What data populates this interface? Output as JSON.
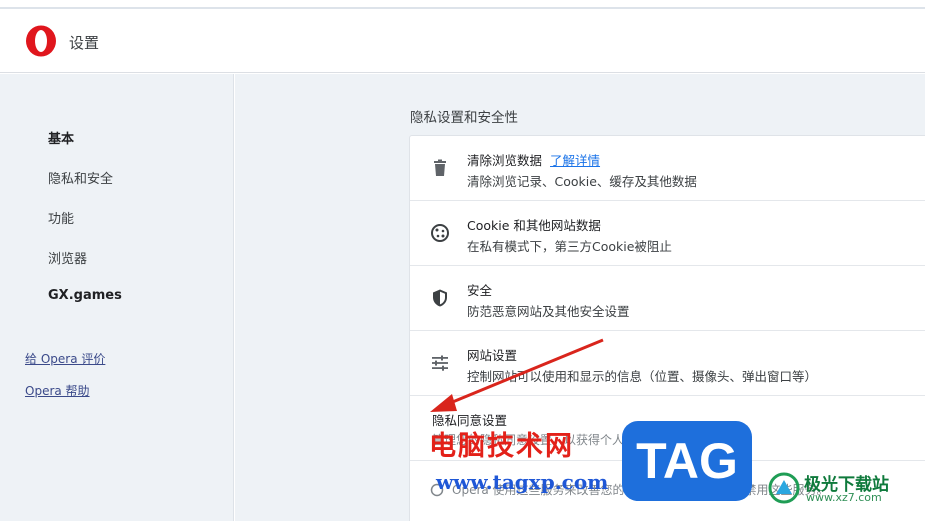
{
  "header": {
    "title": "设置"
  },
  "sidebar": {
    "items": [
      {
        "label": "基本",
        "active": true
      },
      {
        "label": "隐私和安全",
        "active": false
      },
      {
        "label": "功能",
        "active": false
      },
      {
        "label": "浏览器",
        "active": false
      },
      {
        "label": "GX.games",
        "active": false
      }
    ],
    "links": [
      {
        "label": "给 Opera 评价"
      },
      {
        "label": "Opera 帮助"
      }
    ]
  },
  "main": {
    "section_title": "隐私设置和安全性",
    "rows": [
      {
        "icon": "trash-icon",
        "title": "清除浏览数据",
        "link": "了解详情",
        "subtitle": "清除浏览记录、Cookie、缓存及其他数据"
      },
      {
        "icon": "cookie-icon",
        "title": "Cookie 和其他网站数据",
        "subtitle": "在私有模式下，第三方Cookie被阻止"
      },
      {
        "icon": "shield-icon",
        "title": "安全",
        "subtitle": "防范恶意网站及其他安全设置"
      },
      {
        "icon": "sliders-icon",
        "title": "网站设置",
        "subtitle": "控制网站可以使用和显示的信息（位置、摄像头、弹出窗口等）"
      }
    ],
    "consent": {
      "title": "隐私同意设置",
      "subtitle_1": "管理您的隐私同意设置，以获得个人化体验",
      "subtitle_2": "Opera 使用这些服务来改善您的浏览体验。您可以选择禁用这些服务。"
    }
  },
  "watermarks": {
    "cn_text": "电脑技术网",
    "url": "www.tagxp.com",
    "tag": "TAG",
    "site2_name": "极光下载站",
    "site2_url": "www.xz7.com"
  },
  "colors": {
    "opera_red": "#e0161d",
    "link_blue": "#1a73e8",
    "arrow_red": "#d9251c",
    "sidebar_bg": "#eef2f6"
  }
}
